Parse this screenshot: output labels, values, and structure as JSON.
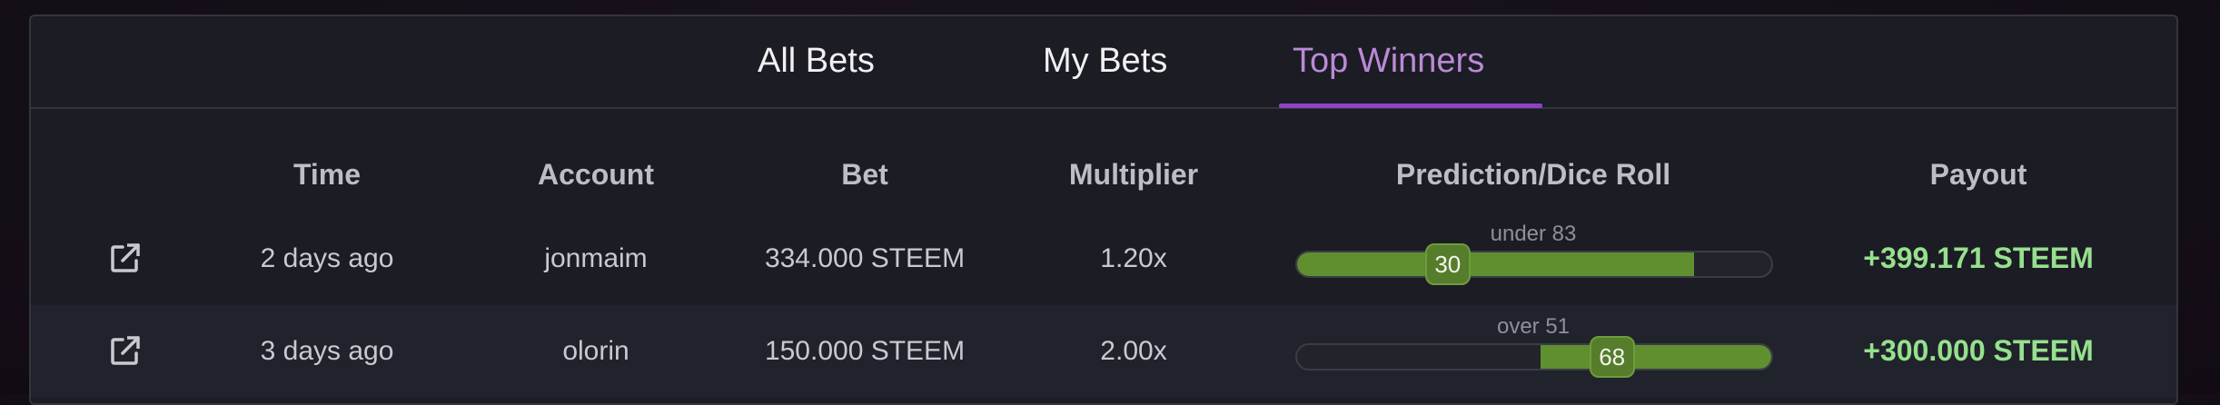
{
  "tabs": [
    {
      "label": "All Bets",
      "active": false
    },
    {
      "label": "My Bets",
      "active": false
    },
    {
      "label": "Top Winners",
      "active": true
    }
  ],
  "table": {
    "columns": [
      "Time",
      "Account",
      "Bet",
      "Multiplier",
      "Prediction/Dice Roll",
      "Payout"
    ],
    "rows": [
      {
        "time": "2 days ago",
        "account": "jonmaim",
        "bet": "334.000 STEEM",
        "multiplier": "1.20x",
        "prediction": "under 83",
        "prediction_type": "under",
        "prediction_value": 83,
        "roll": "30",
        "payout": "+399.171 STEEM"
      },
      {
        "time": "3 days ago",
        "account": "olorin",
        "bet": "150.000 STEEM",
        "multiplier": "2.00x",
        "prediction": "over 51",
        "prediction_type": "over",
        "prediction_value": 51,
        "roll": "68",
        "payout": "+300.000 STEEM"
      }
    ]
  },
  "icons": {
    "open_link": "external-link-icon"
  },
  "colors": {
    "background": "#1c1c24",
    "active_tab": "#b98ad6",
    "tab_underline": "#8c44c2",
    "slider_fill": "#5f8f2f",
    "payout": "#96e08e"
  }
}
